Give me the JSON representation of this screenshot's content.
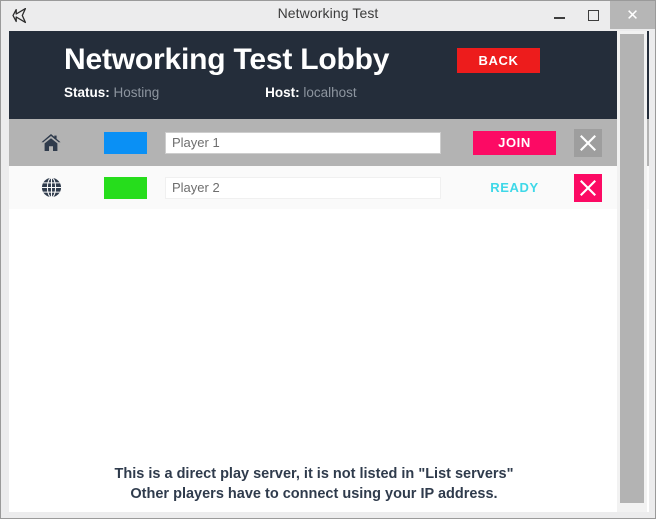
{
  "window": {
    "title": "Networking Test",
    "logo_icon": "unity-logo-icon",
    "controls": {
      "minimize": "minimize-icon",
      "maximize": "maximize-icon",
      "close": "✕"
    }
  },
  "header": {
    "lobby_title": "Networking Test Lobby",
    "back_label": "BACK",
    "status_label": "Status:",
    "status_value": "Hosting",
    "host_label": "Host:",
    "host_value": "localhost"
  },
  "players": [
    {
      "icon": "home-icon",
      "color": "#0a90f5",
      "name": "Player 1",
      "placeholder": "Player 1",
      "action_type": "button",
      "action_label": "JOIN",
      "remove_state": "disabled",
      "remove_icon": "close-icon"
    },
    {
      "icon": "globe-icon",
      "color": "#26dd1c",
      "name": "Player 2",
      "placeholder": "Player 2",
      "action_type": "status",
      "action_label": "READY",
      "remove_state": "active",
      "remove_icon": "close-icon"
    }
  ],
  "footer": {
    "line1": "This is a direct play server, it is not listed in \"List servers\"",
    "line2": "Other players have to connect using your IP address."
  },
  "colors": {
    "header_bg": "#242d3a",
    "accent_pink": "#fc0a64",
    "accent_red": "#ed1c1c",
    "accent_cyan": "#3fd8e8",
    "row_selected": "#b3b3b3"
  }
}
